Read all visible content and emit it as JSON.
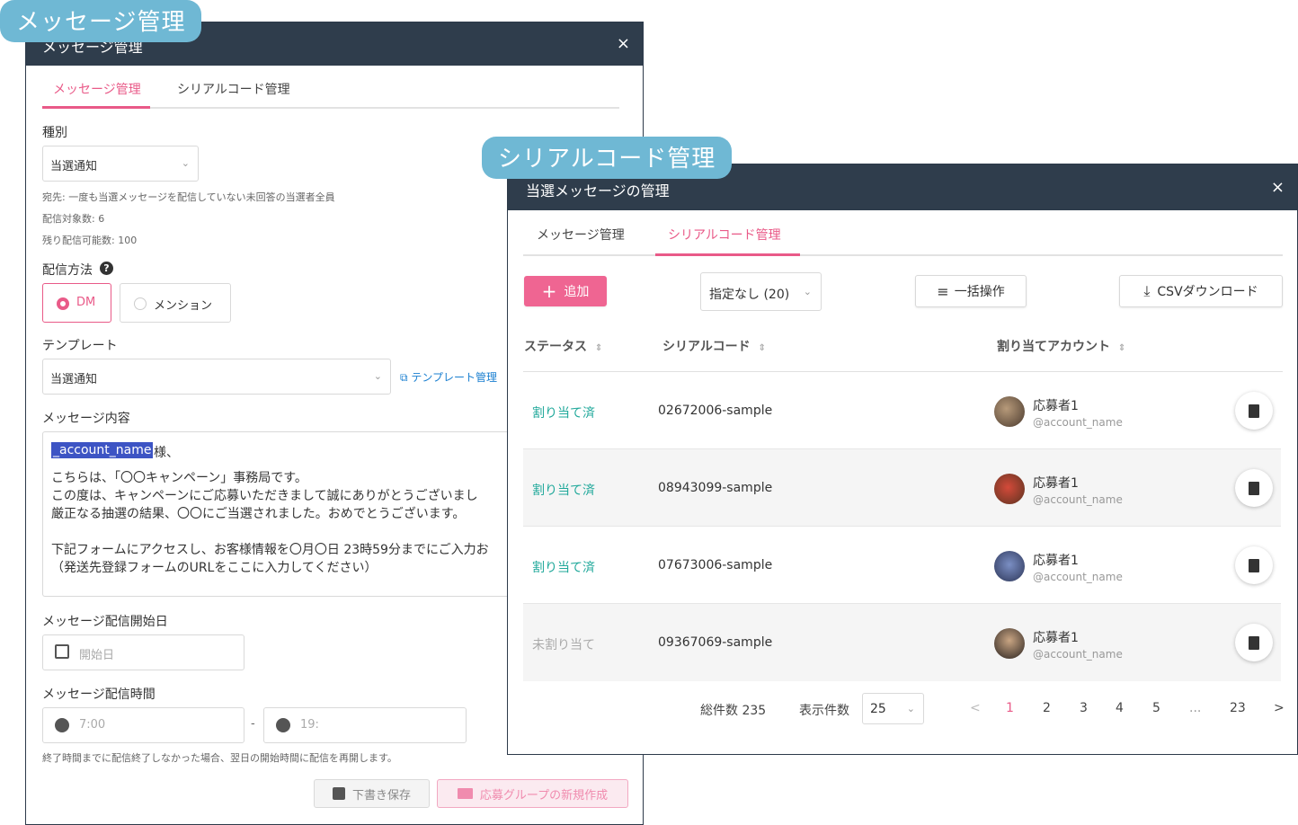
{
  "badges": {
    "message": "メッセージ管理",
    "serial": "シリアルコード管理"
  },
  "left_modal": {
    "title": "メッセージ管理",
    "close": "×",
    "tabs": [
      {
        "label": "メッセージ管理",
        "active": true
      },
      {
        "label": "シリアルコード管理",
        "active": false
      }
    ],
    "type": {
      "label": "種別",
      "value": "当選通知"
    },
    "info": {
      "recipient": "宛先: 一度も当選メッセージを配信していない未回答の当選者全員",
      "target_count": "配信対象数: 6",
      "remaining": "残り配信可能数: 100"
    },
    "delivery": {
      "label": "配信方法",
      "options": [
        {
          "label": "DM",
          "selected": true
        },
        {
          "label": "メンション",
          "selected": false
        }
      ]
    },
    "template": {
      "label": "テンプレート",
      "value": "当選通知",
      "manage_link": "テンプレート管理"
    },
    "message": {
      "label": "メッセージ内容",
      "tag": "_account_name",
      "after_tag": "様、",
      "lines": [
        "こちらは、「〇〇キャンペーン」事務局です。",
        "この度は、キャンペーンにご応募いただきまして誠にありがとうございまし",
        "厳正なる抽選の結果、〇〇にご当選されました。おめでとうございます。",
        "",
        "下記フォームにアクセスし、お客様情報を〇月〇日 23時59分までにご入力お",
        "（発送先登録フォームのURLをここに入力してください）"
      ]
    },
    "start_date": {
      "label": "メッセージ配信開始日",
      "placeholder": "開始日"
    },
    "time": {
      "label": "メッセージ配信時間",
      "from_placeholder": "7:00",
      "separator": "-",
      "to_placeholder": "19:"
    },
    "note": "終了時間までに配信終了しなかった場合、翌日の開始時間に配信を再開します。",
    "buttons": {
      "draft": "下書き保存",
      "create": "応募グループの新規作成"
    }
  },
  "right_modal": {
    "title": "当選メッセージの管理",
    "close": "×",
    "tabs": [
      {
        "label": "メッセージ管理",
        "active": false
      },
      {
        "label": "シリアルコード管理",
        "active": true
      }
    ],
    "toolbar": {
      "add": "追加",
      "filter": "指定なし (20)",
      "bulk": "一括操作",
      "csv": "CSVダウンロード"
    },
    "columns": [
      "ステータス",
      "シリアルコード",
      "割り当てアカウント"
    ],
    "rows": [
      {
        "status": "割り当て済",
        "assigned": true,
        "code": "02672006-sample",
        "name": "応募者1",
        "account": "@account_name"
      },
      {
        "status": "割り当て済",
        "assigned": true,
        "code": "08943099-sample",
        "name": "応募者1",
        "account": "@account_name"
      },
      {
        "status": "割り当て済",
        "assigned": true,
        "code": "07673006-sample",
        "name": "応募者1",
        "account": "@account_name"
      },
      {
        "status": "未割り当て",
        "assigned": false,
        "code": "09367069-sample",
        "name": "応募者1",
        "account": "@account_name"
      }
    ],
    "pagination": {
      "total": "総件数 235",
      "per_page_label": "表示件数",
      "per_page": "25",
      "prev": "<",
      "pages": [
        "1",
        "2",
        "3",
        "4",
        "5",
        "...",
        "23"
      ],
      "current": "1",
      "next": ">"
    }
  },
  "colors": {
    "accent": "#e95a88",
    "teal": "#1fa89a",
    "header": "#2f3d4c",
    "badge": "#6fb8d4"
  }
}
